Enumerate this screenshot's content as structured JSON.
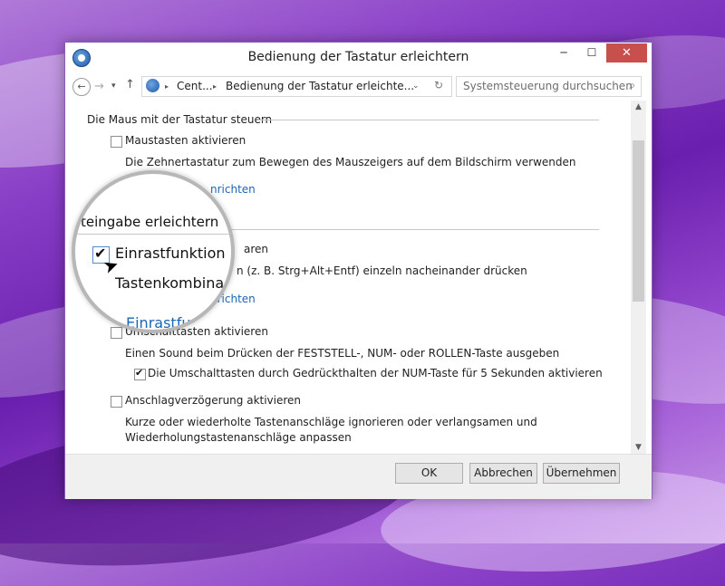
{
  "window": {
    "title": "Bedienung der Tastatur erleichtern",
    "minimize_glyph": "─",
    "maximize_glyph": "☐",
    "close_glyph": "✕"
  },
  "address": {
    "back_glyph": "←",
    "forward_glyph": "→",
    "dropdown_glyph": "▾",
    "up_glyph": "↑",
    "crumb_sep": "▸",
    "crumb_1": "Cent...",
    "crumb_2": "Bedienung der Tastatur erleichte...",
    "chevron_glyph": "⌄",
    "refresh_glyph": "↻",
    "search_placeholder": "Systemsteuerung durchsuchen",
    "search_glyph": "⌕"
  },
  "sections": {
    "mouse": {
      "heading": "Die Maus mit der Tastatur steuern",
      "checkbox_label": "Maustasten aktivieren",
      "checked": false,
      "description": "Die Zehnertastatur zum Bewegen des Mauszeigers auf dem Bildschirm verwenden",
      "link_partial": "nrichten"
    },
    "typing": {
      "heading_partial": "teingabe erleichtern",
      "sticky_label_partial": "aren",
      "sticky_checked": true,
      "sticky_desc_partial": "n (z. B. Strg+Alt+Entf) einzeln nacheinander drücken",
      "sticky_link_partial": "nrichten",
      "toggle_label": "Umschalttasten aktivieren",
      "toggle_checked": false,
      "toggle_desc": "Einen Sound beim Drücken der FESTSTELL-, NUM- oder ROLLEN-Taste ausgeben",
      "toggle_sub_label": "Die Umschalttasten durch Gedrückthalten der NUM-Taste für 5 Sekunden aktivieren",
      "toggle_sub_checked": true,
      "filter_label": "Anschlagverzögerung aktivieren",
      "filter_checked": false,
      "filter_desc_1": "Kurze oder wiederholte Tastenanschläge ignorieren oder verlangsamen und",
      "filter_desc_2": "Wiederholungstastenanschläge anpassen"
    }
  },
  "magnifier": {
    "heading": "teingabe erleichtern",
    "checkbox_label": "Einrastfunktion",
    "sub_text": "Tastenkombina",
    "link_text": "Einrastfu"
  },
  "scroll": {
    "up_glyph": "▲",
    "down_glyph": "▼",
    "position": 0.2
  },
  "buttons": {
    "ok": "OK",
    "cancel": "Abbrechen",
    "apply": "Übernehmen"
  }
}
